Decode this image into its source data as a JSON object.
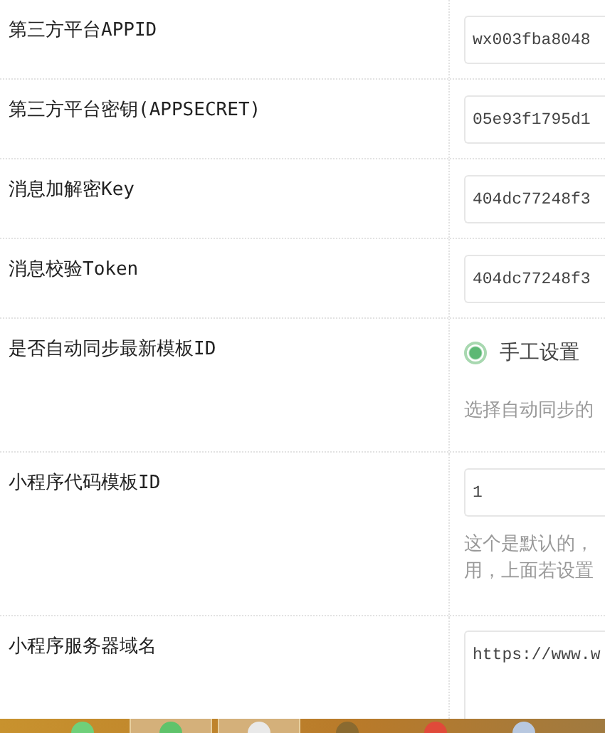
{
  "rows": [
    {
      "kind": "input",
      "label": "第三方平台APPID",
      "value": "wx003fba8048"
    },
    {
      "kind": "input",
      "label": "第三方平台密钥(APPSECRET)",
      "value": "05e93f1795d1"
    },
    {
      "kind": "input",
      "label": "消息加解密Key",
      "value": "404dc77248f3"
    },
    {
      "kind": "input",
      "label": "消息校验Token",
      "value": "404dc77248f3"
    },
    {
      "kind": "radio",
      "label": "是否自动同步最新模板ID",
      "options": [
        {
          "label": "手工设置",
          "selected": true
        }
      ],
      "help": [
        "选择自动同步的"
      ]
    },
    {
      "kind": "input",
      "label": "小程序代码模板ID",
      "value": "1",
      "help": [
        "这个是默认的，",
        "用，上面若设置"
      ]
    },
    {
      "kind": "textarea",
      "label": "小程序服务器域名",
      "value": "https://www.w"
    }
  ],
  "taskbar": {
    "buttons": [
      {
        "selected": false
      },
      {
        "selected": true
      },
      {
        "selected": true
      },
      {
        "selected": false
      },
      {
        "selected": false
      },
      {
        "selected": false
      }
    ]
  }
}
